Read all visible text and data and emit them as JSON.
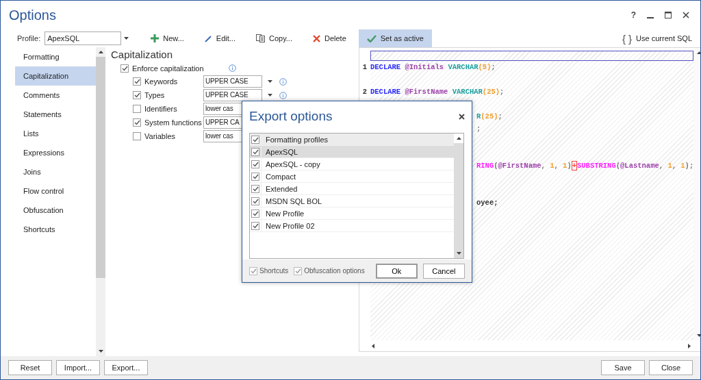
{
  "window": {
    "title": "Options",
    "help": "?"
  },
  "toolbar": {
    "profile_label": "Profile:",
    "profile_value": "ApexSQL",
    "buttons": [
      {
        "label": "New...",
        "kind": "add",
        "selected": false
      },
      {
        "label": "Edit...",
        "kind": "edit",
        "selected": false
      },
      {
        "label": "Copy...",
        "kind": "copy",
        "selected": false
      },
      {
        "label": "Delete",
        "kind": "delete",
        "selected": false
      },
      {
        "label": "Set as active",
        "kind": "activate",
        "selected": true
      }
    ],
    "use_current_sql": {
      "glyph": "{ }",
      "label": "Use current SQL"
    }
  },
  "sidebar": {
    "items": [
      {
        "label": "Formatting",
        "selected": false
      },
      {
        "label": "Capitalization",
        "selected": true
      },
      {
        "label": "Comments",
        "selected": false
      },
      {
        "label": "Statements",
        "selected": false
      },
      {
        "label": "Lists",
        "selected": false
      },
      {
        "label": "Expressions",
        "selected": false
      },
      {
        "label": "Joins",
        "selected": false
      },
      {
        "label": "Flow control",
        "selected": false
      },
      {
        "label": "Obfuscation",
        "selected": false
      },
      {
        "label": "Shortcuts",
        "selected": false
      }
    ]
  },
  "section": {
    "title": "Capitalization",
    "enforce": {
      "label": "Enforce capitalization",
      "checked": true
    },
    "options": [
      {
        "label": "Keywords",
        "checked": true,
        "value": "UPPER CASE",
        "info": true
      },
      {
        "label": "Types",
        "checked": true,
        "value": "UPPER CASE",
        "info": true
      },
      {
        "label": "Identifiers",
        "checked": false,
        "value": "lower cas"
      },
      {
        "label": "System functions",
        "checked": true,
        "value": "UPPER CA"
      },
      {
        "label": "Variables",
        "checked": false,
        "value": "lower cas"
      }
    ]
  },
  "editor": {
    "lines": [
      {
        "kind": "code",
        "number": "1",
        "tokens": [
          {
            "text": "DECLARE",
            "kind": "keyword"
          },
          {
            "text": " @Initials",
            "kind": "variable"
          },
          {
            "text": " VARCHAR",
            "kind": "type"
          },
          {
            "text": "(5)",
            "kind": "number"
          },
          {
            "text": ";",
            "kind": "punct"
          }
        ]
      },
      {
        "kind": "blank"
      },
      {
        "kind": "code",
        "number": "2",
        "tokens": [
          {
            "text": "DECLARE",
            "kind": "keyword"
          },
          {
            "text": " @FirstName",
            "kind": "variable"
          },
          {
            "text": " VARCHAR",
            "kind": "type"
          },
          {
            "text": "(25)",
            "kind": "number"
          },
          {
            "text": ";",
            "kind": "punct"
          }
        ]
      },
      {
        "kind": "blank"
      },
      {
        "kind": "partial",
        "tokens": [
          {
            "text": "R",
            "kind": "type"
          },
          {
            "text": "(25)",
            "kind": "number"
          },
          {
            "text": ";",
            "kind": "punct"
          }
        ]
      },
      {
        "kind": "partial",
        "tokens": [
          {
            "text": ";",
            "kind": "punct"
          }
        ]
      },
      {
        "kind": "blank"
      },
      {
        "kind": "blank"
      },
      {
        "kind": "partial",
        "tokens": [
          {
            "text": "RING",
            "kind": "function"
          },
          {
            "text": "(",
            "kind": "punct"
          },
          {
            "text": "@FirstName",
            "kind": "variable"
          },
          {
            "text": ", ",
            "kind": "punct"
          },
          {
            "text": "1",
            "kind": "number"
          },
          {
            "text": ", ",
            "kind": "punct"
          },
          {
            "text": "1",
            "kind": "number"
          },
          {
            "text": ")",
            "kind": "punct"
          },
          {
            "text": "+",
            "kind": "operator"
          },
          {
            "text": "SUBSTRING",
            "kind": "function"
          },
          {
            "text": "(",
            "kind": "punct"
          },
          {
            "text": "@Lastname",
            "kind": "variable"
          },
          {
            "text": ", ",
            "kind": "punct"
          },
          {
            "text": "1",
            "kind": "number"
          },
          {
            "text": ", ",
            "kind": "punct"
          },
          {
            "text": "1",
            "kind": "number"
          },
          {
            "text": ");",
            "kind": "punct"
          }
        ]
      },
      {
        "kind": "blank"
      },
      {
        "kind": "blank"
      },
      {
        "kind": "partial",
        "tokens": [
          {
            "text": "oyee;",
            "kind": "plain"
          }
        ]
      },
      {
        "kind": "blank"
      },
      {
        "kind": "blank"
      }
    ]
  },
  "export_dialog": {
    "title": "Export options",
    "header": {
      "label": "Formatting profiles",
      "checked": true
    },
    "items": [
      {
        "label": "ApexSQL",
        "checked": true,
        "selected": true
      },
      {
        "label": "ApexSQL - copy",
        "checked": true,
        "selected": false
      },
      {
        "label": "Compact",
        "checked": true,
        "selected": false
      },
      {
        "label": "Extended",
        "checked": true,
        "selected": false
      },
      {
        "label": "MSDN SQL BOL",
        "checked": true,
        "selected": false
      },
      {
        "label": "New Profile",
        "checked": true,
        "selected": false
      },
      {
        "label": "New Profile 02",
        "checked": true,
        "selected": false
      }
    ],
    "options": [
      {
        "label": "Shortcuts",
        "checked": true
      },
      {
        "label": "Obfuscation options",
        "checked": true
      }
    ],
    "buttons": [
      "Ok",
      "Cancel"
    ]
  },
  "footer": {
    "left_buttons": [
      "Reset",
      "Import...",
      "Export..."
    ],
    "right_buttons": [
      "Save",
      "Close"
    ]
  }
}
